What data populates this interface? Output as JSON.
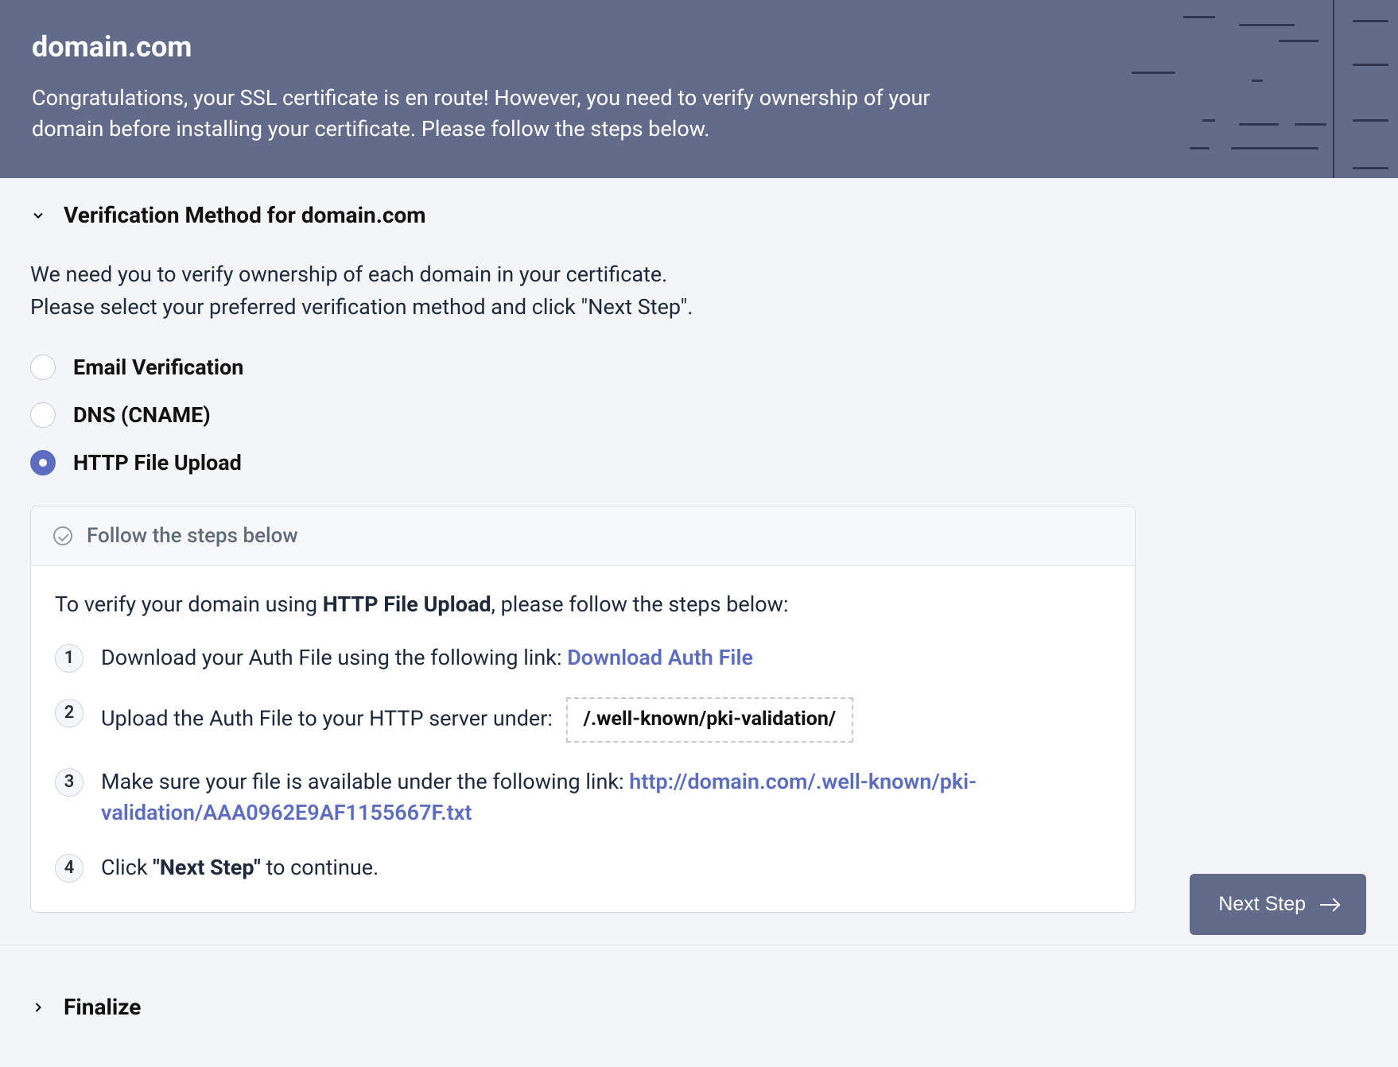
{
  "header": {
    "title": "domain.com",
    "description": "Congratulations, your SSL certificate is en route! However, you need to verify ownership of your domain before installing your certificate. Please follow the steps below."
  },
  "verification": {
    "section_title": "Verification Method for domain.com",
    "intro_line1": "We need you to verify ownership of each domain in your certificate.",
    "intro_line2": "Please select your preferred verification method and click \"Next Step\".",
    "options": [
      {
        "label": "Email Verification",
        "selected": false
      },
      {
        "label": "DNS (CNAME)",
        "selected": false
      },
      {
        "label": "HTTP File Upload",
        "selected": true
      }
    ],
    "steps_card": {
      "header": "Follow the steps below",
      "intro_prefix": "To verify your domain using ",
      "intro_bold": "HTTP File Upload",
      "intro_suffix": ", please follow the steps below:",
      "steps": {
        "1": {
          "text": "Download your Auth File using the following link: ",
          "link": "Download Auth File"
        },
        "2": {
          "text": "Upload the Auth File to your HTTP server under:",
          "path": "/.well-known/pki-validation/"
        },
        "3": {
          "text": "Make sure your file is available under the following link: ",
          "link": "http://domain.com/.well-known/pki-validation/AAA0962E9AF1155667F.txt"
        },
        "4": {
          "prefix": "Click ",
          "bold": "\"Next Step\"",
          "suffix": " to continue."
        }
      }
    }
  },
  "actions": {
    "next_step": "Next Step"
  },
  "finalize": {
    "title": "Finalize"
  }
}
